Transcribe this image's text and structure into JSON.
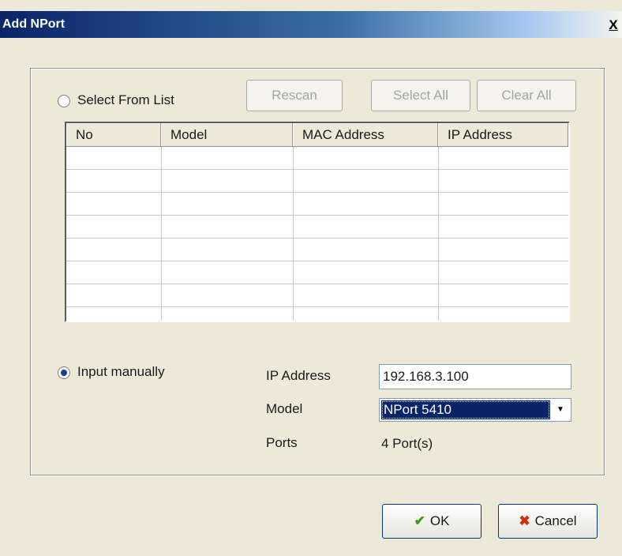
{
  "window": {
    "title": "Add NPort",
    "close_glyph": "X"
  },
  "select_from_list": {
    "label": "Select From List",
    "selected": false,
    "buttons": {
      "rescan": "Rescan",
      "select_all": "Select All",
      "clear_all": "Clear All"
    }
  },
  "table": {
    "columns": [
      "No",
      "Model",
      "MAC Address",
      "IP Address"
    ],
    "rows": [
      [],
      [],
      [],
      [],
      [],
      [],
      [],
      []
    ]
  },
  "input_manually": {
    "label": "Input manually",
    "selected": true
  },
  "fields": {
    "ip_label": "IP Address",
    "ip_value": "192.168.3.100",
    "model_label": "Model",
    "model_value": "NPort 5410",
    "ports_label": "Ports",
    "ports_value": "4 Port(s)"
  },
  "footer": {
    "ok_label": "OK",
    "ok_icon": "checkmark-icon",
    "cancel_label": "Cancel",
    "cancel_icon": "x-icon"
  },
  "colors": {
    "title_bar": "#0a246a",
    "selection": "#0a246a",
    "dialog_bg": "#ece9d8"
  }
}
